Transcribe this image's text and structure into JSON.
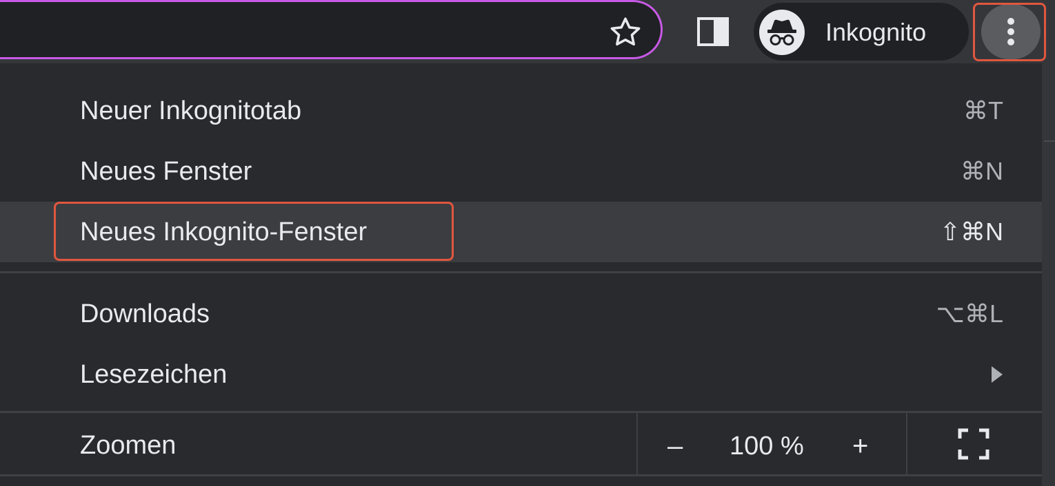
{
  "toolbar": {
    "profile_label": "Inkognito"
  },
  "menu": {
    "items": [
      {
        "label": "Neuer Inkognitotab",
        "shortcut": "⌘T"
      },
      {
        "label": "Neues Fenster",
        "shortcut": "⌘N"
      },
      {
        "label": "Neues Inkognito-Fenster",
        "shortcut": "⇧⌘N"
      },
      {
        "label": "Downloads",
        "shortcut": "⌥⌘L"
      },
      {
        "label": "Lesezeichen",
        "shortcut": ""
      }
    ],
    "zoom": {
      "label": "Zoomen",
      "minus": "–",
      "value": "100 %",
      "plus": "+"
    }
  },
  "colors": {
    "omnibox_border": "#c85ae6",
    "annotation_red": "#e0573f",
    "menu_bg": "#292a2d",
    "highlight_bg": "#3c3d40"
  },
  "icons": {
    "bookmark": "star-icon",
    "side_panel": "side-panel-icon",
    "incognito": "incognito-icon",
    "menu": "more-vert-icon",
    "submenu": "chevron-right-icon",
    "fullscreen": "fullscreen-icon"
  }
}
